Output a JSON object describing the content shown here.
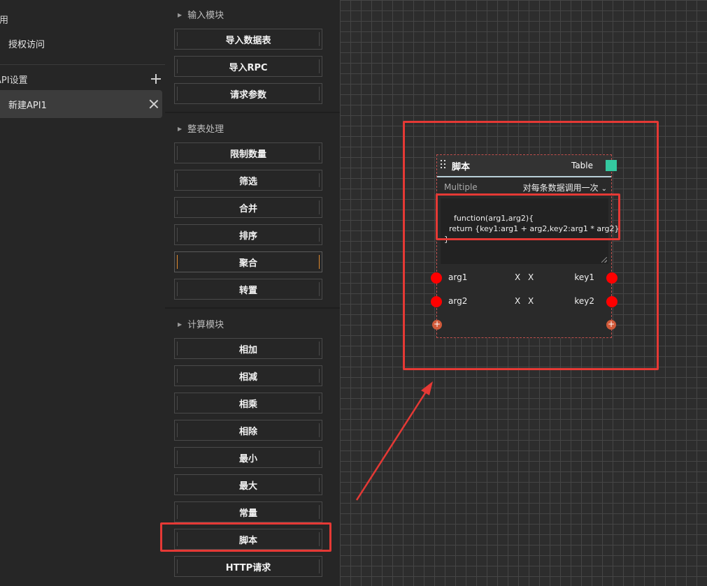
{
  "sidebar": {
    "section_general": "通用",
    "auth_item": "授权访问",
    "section_api": "API设置",
    "api_item": "新建API1"
  },
  "palette": {
    "groups": [
      {
        "title": "输入模块",
        "items": [
          "导入数据表",
          "导入RPC",
          "请求参数"
        ]
      },
      {
        "title": "整表处理",
        "items": [
          "限制数量",
          "筛选",
          "合并",
          "排序",
          "聚合",
          "转置"
        ]
      },
      {
        "title": "计算模块",
        "items": [
          "相加",
          "相减",
          "相乘",
          "相除",
          "最小",
          "最大",
          "常量",
          "脚本",
          "HTTP请求"
        ]
      }
    ],
    "active_item": "聚合",
    "highlighted_item": "脚本"
  },
  "node": {
    "title": "脚本",
    "type": "Table",
    "type_color": "#34c9a0",
    "mode_label": "Multiple",
    "mode_value": "对每条数据调用一次",
    "code": "function(arg1,arg2){\n  return {key1:arg1 + arg2,key2:arg1 * arg2}\n}",
    "ports": [
      {
        "arg": "arg1",
        "x1": "X",
        "x2": "X",
        "key": "key1"
      },
      {
        "arg": "arg2",
        "x1": "X",
        "x2": "X",
        "key": "key2"
      }
    ],
    "add_port_symbol": "+"
  },
  "colors": {
    "port": "#ff0000",
    "highlight": "#e53935",
    "accent_active": "#e08a2e"
  }
}
